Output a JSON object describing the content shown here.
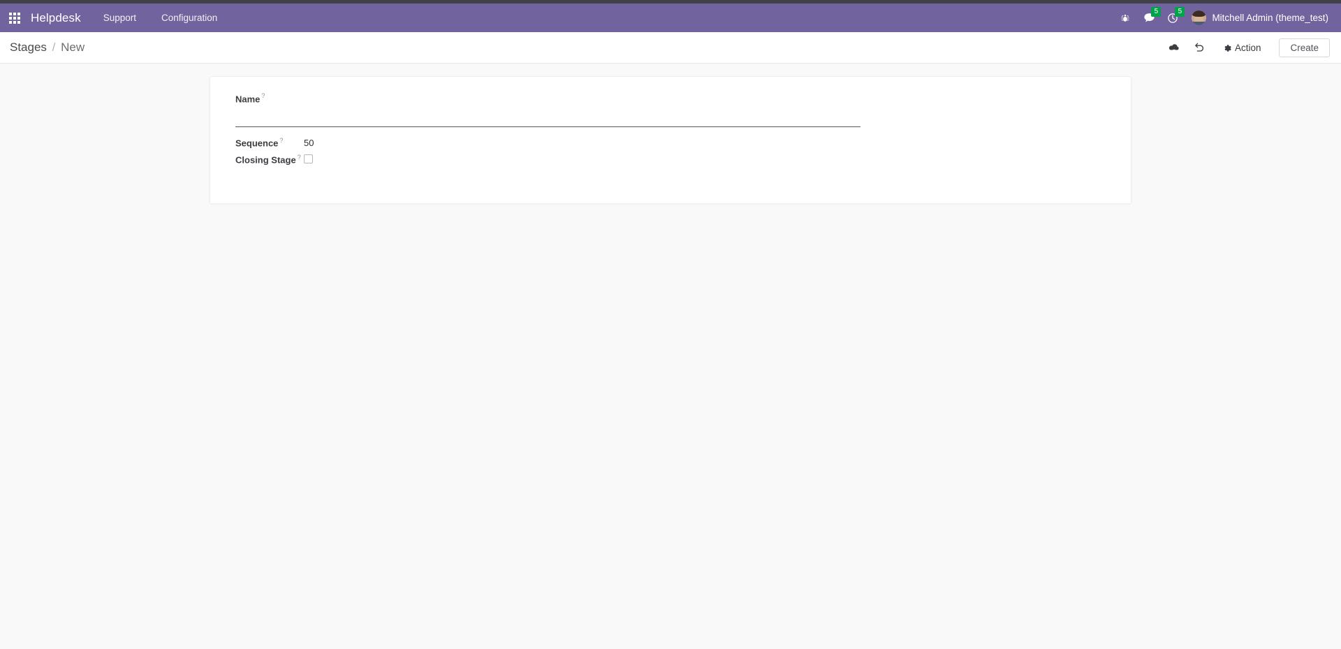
{
  "navbar": {
    "apps_icon": "apps-grid-icon",
    "brand": "Helpdesk",
    "menu_items": [
      {
        "label": "Support"
      },
      {
        "label": "Configuration"
      }
    ],
    "debug_icon": "bug-icon",
    "messages": {
      "icon": "chat-bubble-icon",
      "count": "5"
    },
    "activities": {
      "icon": "clock-icon",
      "count": "5"
    },
    "user": {
      "avatar": "user-avatar",
      "name": "Mitchell Admin (theme_test)"
    },
    "colors": {
      "background": "#71639e",
      "badge": "#00a34b",
      "top_strip": "#41414a"
    }
  },
  "control_panel": {
    "breadcrumb": {
      "parent": "Stages",
      "separator": "/",
      "current": "New"
    },
    "save_icon": "cloud-upload-icon",
    "discard_icon": "undo-icon",
    "action": {
      "icon": "gear-icon",
      "label": "Action"
    },
    "create_label": "Create"
  },
  "form": {
    "fields": {
      "name": {
        "label": "Name",
        "tooltip_marker": "?",
        "value": "",
        "placeholder": ""
      },
      "sequence": {
        "label": "Sequence",
        "tooltip_marker": "?",
        "value": "50"
      },
      "closing_stage": {
        "label": "Closing Stage",
        "tooltip_marker": "?",
        "checked": false
      }
    }
  }
}
